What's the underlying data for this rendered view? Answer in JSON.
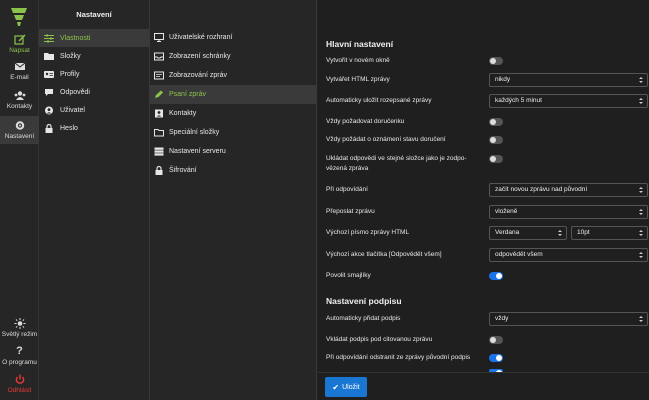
{
  "rail": {
    "compose": "Napsat",
    "email": "E-mail",
    "contacts": "Kontakty",
    "settings": "Nastavení",
    "theme": "Světlý režim",
    "about": "O programu",
    "logout": "Odhlásit"
  },
  "settings_nav": {
    "title": "Nastavení",
    "items": [
      {
        "label": "Vlastnosti",
        "icon": "sliders-icon"
      },
      {
        "label": "Složky",
        "icon": "folder-icon"
      },
      {
        "label": "Profily",
        "icon": "id-card-icon"
      },
      {
        "label": "Odpovědi",
        "icon": "reply-icon"
      },
      {
        "label": "Uživatel",
        "icon": "user-icon"
      },
      {
        "label": "Heslo",
        "icon": "lock-icon"
      }
    ]
  },
  "sections": {
    "items": [
      {
        "label": "Uživatelské rozhraní",
        "icon": "monitor-icon"
      },
      {
        "label": "Zobrazení schránky",
        "icon": "inbox-icon"
      },
      {
        "label": "Zobrazování zpráv",
        "icon": "message-icon"
      },
      {
        "label": "Psaní zpráv",
        "icon": "pen-icon"
      },
      {
        "label": "Kontakty",
        "icon": "contacts-icon"
      },
      {
        "label": "Speciální složky",
        "icon": "folder-icon"
      },
      {
        "label": "Nastavení serveru",
        "icon": "server-icon"
      },
      {
        "label": "Šifrování",
        "icon": "lock-icon"
      }
    ]
  },
  "main": {
    "section1_title": "Hlavní nastavení",
    "open_new_window": "Vytvořit v novém okně",
    "html_compose": "Vytvářet HTML zprávy",
    "html_compose_value": "nikdy",
    "autosave": "Automaticky uložit rozepsané zprávy",
    "autosave_value": "každých 5 minut",
    "delivery_receipt": "Vždy požadovat doručenku",
    "dsn": "Vždy požádat o oznámení stavu doručení",
    "save_reply": "Ukládat odpovědi ve stejné složce jako je zodpo-vězená zpráva",
    "on_reply": "Při odpovídání",
    "on_reply_value": "začít novou zprávu nad původní",
    "forward": "Přeposlat zprávu",
    "forward_value": "vloženě",
    "html_font": "Výchozí písmo zprávy HTML",
    "html_font_value": "Verdana",
    "html_font_size": "10pt",
    "reply_all": "Výchozí akce tlačítka [Odpovědět všem]",
    "reply_all_value": "odpovědět všem",
    "emoticons": "Povolit smajlíky",
    "section2_title": "Nastavení podpisu",
    "add_signature": "Automaticky přidat podpis",
    "add_signature_value": "vždy",
    "sig_below_quote": "Vkládat podpis pod citovanou zprávu",
    "strip_signature": "Při odpovídání odstranit ze zprávy původní podpis",
    "save_button": "Uložit"
  },
  "colors": {
    "accent": "#8bc34a",
    "primary": "#1976d2",
    "danger": "#e53935"
  }
}
